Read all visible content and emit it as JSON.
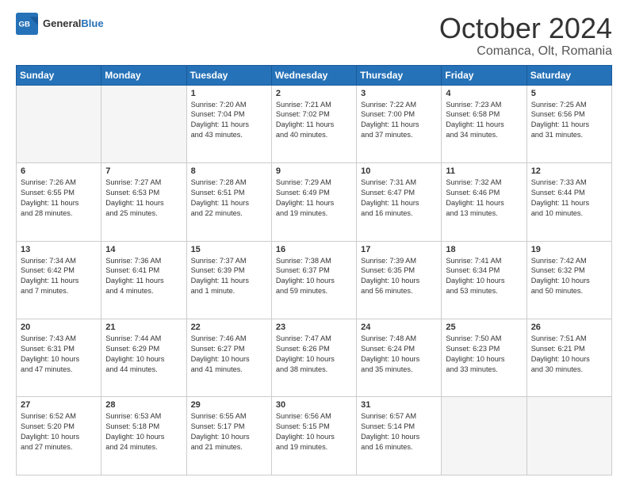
{
  "header": {
    "logo_general": "General",
    "logo_blue": "Blue",
    "month_title": "October 2024",
    "location": "Comanca, Olt, Romania"
  },
  "days_of_week": [
    "Sunday",
    "Monday",
    "Tuesday",
    "Wednesday",
    "Thursday",
    "Friday",
    "Saturday"
  ],
  "weeks": [
    [
      {
        "day": "",
        "info": ""
      },
      {
        "day": "",
        "info": ""
      },
      {
        "day": "1",
        "info": "Sunrise: 7:20 AM\nSunset: 7:04 PM\nDaylight: 11 hours\nand 43 minutes."
      },
      {
        "day": "2",
        "info": "Sunrise: 7:21 AM\nSunset: 7:02 PM\nDaylight: 11 hours\nand 40 minutes."
      },
      {
        "day": "3",
        "info": "Sunrise: 7:22 AM\nSunset: 7:00 PM\nDaylight: 11 hours\nand 37 minutes."
      },
      {
        "day": "4",
        "info": "Sunrise: 7:23 AM\nSunset: 6:58 PM\nDaylight: 11 hours\nand 34 minutes."
      },
      {
        "day": "5",
        "info": "Sunrise: 7:25 AM\nSunset: 6:56 PM\nDaylight: 11 hours\nand 31 minutes."
      }
    ],
    [
      {
        "day": "6",
        "info": "Sunrise: 7:26 AM\nSunset: 6:55 PM\nDaylight: 11 hours\nand 28 minutes."
      },
      {
        "day": "7",
        "info": "Sunrise: 7:27 AM\nSunset: 6:53 PM\nDaylight: 11 hours\nand 25 minutes."
      },
      {
        "day": "8",
        "info": "Sunrise: 7:28 AM\nSunset: 6:51 PM\nDaylight: 11 hours\nand 22 minutes."
      },
      {
        "day": "9",
        "info": "Sunrise: 7:29 AM\nSunset: 6:49 PM\nDaylight: 11 hours\nand 19 minutes."
      },
      {
        "day": "10",
        "info": "Sunrise: 7:31 AM\nSunset: 6:47 PM\nDaylight: 11 hours\nand 16 minutes."
      },
      {
        "day": "11",
        "info": "Sunrise: 7:32 AM\nSunset: 6:46 PM\nDaylight: 11 hours\nand 13 minutes."
      },
      {
        "day": "12",
        "info": "Sunrise: 7:33 AM\nSunset: 6:44 PM\nDaylight: 11 hours\nand 10 minutes."
      }
    ],
    [
      {
        "day": "13",
        "info": "Sunrise: 7:34 AM\nSunset: 6:42 PM\nDaylight: 11 hours\nand 7 minutes."
      },
      {
        "day": "14",
        "info": "Sunrise: 7:36 AM\nSunset: 6:41 PM\nDaylight: 11 hours\nand 4 minutes."
      },
      {
        "day": "15",
        "info": "Sunrise: 7:37 AM\nSunset: 6:39 PM\nDaylight: 11 hours\nand 1 minute."
      },
      {
        "day": "16",
        "info": "Sunrise: 7:38 AM\nSunset: 6:37 PM\nDaylight: 10 hours\nand 59 minutes."
      },
      {
        "day": "17",
        "info": "Sunrise: 7:39 AM\nSunset: 6:35 PM\nDaylight: 10 hours\nand 56 minutes."
      },
      {
        "day": "18",
        "info": "Sunrise: 7:41 AM\nSunset: 6:34 PM\nDaylight: 10 hours\nand 53 minutes."
      },
      {
        "day": "19",
        "info": "Sunrise: 7:42 AM\nSunset: 6:32 PM\nDaylight: 10 hours\nand 50 minutes."
      }
    ],
    [
      {
        "day": "20",
        "info": "Sunrise: 7:43 AM\nSunset: 6:31 PM\nDaylight: 10 hours\nand 47 minutes."
      },
      {
        "day": "21",
        "info": "Sunrise: 7:44 AM\nSunset: 6:29 PM\nDaylight: 10 hours\nand 44 minutes."
      },
      {
        "day": "22",
        "info": "Sunrise: 7:46 AM\nSunset: 6:27 PM\nDaylight: 10 hours\nand 41 minutes."
      },
      {
        "day": "23",
        "info": "Sunrise: 7:47 AM\nSunset: 6:26 PM\nDaylight: 10 hours\nand 38 minutes."
      },
      {
        "day": "24",
        "info": "Sunrise: 7:48 AM\nSunset: 6:24 PM\nDaylight: 10 hours\nand 35 minutes."
      },
      {
        "day": "25",
        "info": "Sunrise: 7:50 AM\nSunset: 6:23 PM\nDaylight: 10 hours\nand 33 minutes."
      },
      {
        "day": "26",
        "info": "Sunrise: 7:51 AM\nSunset: 6:21 PM\nDaylight: 10 hours\nand 30 minutes."
      }
    ],
    [
      {
        "day": "27",
        "info": "Sunrise: 6:52 AM\nSunset: 5:20 PM\nDaylight: 10 hours\nand 27 minutes."
      },
      {
        "day": "28",
        "info": "Sunrise: 6:53 AM\nSunset: 5:18 PM\nDaylight: 10 hours\nand 24 minutes."
      },
      {
        "day": "29",
        "info": "Sunrise: 6:55 AM\nSunset: 5:17 PM\nDaylight: 10 hours\nand 21 minutes."
      },
      {
        "day": "30",
        "info": "Sunrise: 6:56 AM\nSunset: 5:15 PM\nDaylight: 10 hours\nand 19 minutes."
      },
      {
        "day": "31",
        "info": "Sunrise: 6:57 AM\nSunset: 5:14 PM\nDaylight: 10 hours\nand 16 minutes."
      },
      {
        "day": "",
        "info": ""
      },
      {
        "day": "",
        "info": ""
      }
    ]
  ]
}
